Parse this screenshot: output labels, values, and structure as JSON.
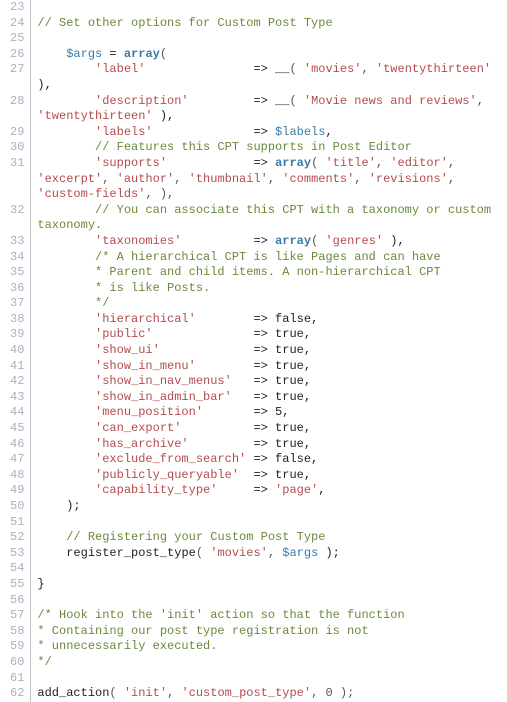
{
  "lines": [
    {
      "n": 23,
      "tokens": []
    },
    {
      "n": 24,
      "tokens": [
        {
          "c": "tok-comment",
          "t": "// Set other options for Custom Post Type"
        }
      ]
    },
    {
      "n": 25,
      "tokens": []
    },
    {
      "n": 26,
      "tokens": [
        {
          "c": "tok-plain",
          "t": "    "
        },
        {
          "c": "tok-var",
          "t": "$args"
        },
        {
          "c": "tok-plain",
          "t": " = "
        },
        {
          "c": "tok-keyword",
          "t": "array"
        },
        {
          "c": "tok-punct",
          "t": "("
        }
      ]
    },
    {
      "n": 27,
      "tokens": [
        {
          "c": "tok-plain",
          "t": "        "
        },
        {
          "c": "tok-string",
          "t": "'label'"
        },
        {
          "c": "tok-plain",
          "t": "               => "
        },
        {
          "c": "tok-func",
          "t": "__"
        },
        {
          "c": "tok-punct",
          "t": "( "
        },
        {
          "c": "tok-string",
          "t": "'movies'"
        },
        {
          "c": "tok-punct",
          "t": ", "
        },
        {
          "c": "tok-string",
          "t": "'twentythirteen'"
        },
        {
          "c": "tok-plain",
          "t": " ),"
        }
      ]
    },
    {
      "n": 28,
      "tokens": [
        {
          "c": "tok-plain",
          "t": "        "
        },
        {
          "c": "tok-string",
          "t": "'description'"
        },
        {
          "c": "tok-plain",
          "t": "         => "
        },
        {
          "c": "tok-func",
          "t": "__"
        },
        {
          "c": "tok-punct",
          "t": "( "
        },
        {
          "c": "tok-string",
          "t": "'Movie news and reviews'"
        },
        {
          "c": "tok-punct",
          "t": ", "
        },
        {
          "c": "tok-string",
          "t": "'twentythirteen'"
        },
        {
          "c": "tok-plain",
          "t": " ),"
        }
      ]
    },
    {
      "n": 29,
      "tokens": [
        {
          "c": "tok-plain",
          "t": "        "
        },
        {
          "c": "tok-string",
          "t": "'labels'"
        },
        {
          "c": "tok-plain",
          "t": "              => "
        },
        {
          "c": "tok-var",
          "t": "$labels"
        },
        {
          "c": "tok-plain",
          "t": ","
        }
      ]
    },
    {
      "n": 30,
      "tokens": [
        {
          "c": "tok-plain",
          "t": "        "
        },
        {
          "c": "tok-comment",
          "t": "// Features this CPT supports in Post Editor"
        }
      ]
    },
    {
      "n": 31,
      "tokens": [
        {
          "c": "tok-plain",
          "t": "        "
        },
        {
          "c": "tok-string",
          "t": "'supports'"
        },
        {
          "c": "tok-plain",
          "t": "            => "
        },
        {
          "c": "tok-keyword",
          "t": "array"
        },
        {
          "c": "tok-punct",
          "t": "( "
        },
        {
          "c": "tok-string",
          "t": "'title'"
        },
        {
          "c": "tok-punct",
          "t": ", "
        },
        {
          "c": "tok-string",
          "t": "'editor'"
        },
        {
          "c": "tok-punct",
          "t": ", "
        },
        {
          "c": "tok-string",
          "t": "'excerpt'"
        },
        {
          "c": "tok-punct",
          "t": ", "
        },
        {
          "c": "tok-string",
          "t": "'author'"
        },
        {
          "c": "tok-punct",
          "t": ", "
        },
        {
          "c": "tok-string",
          "t": "'thumbnail'"
        },
        {
          "c": "tok-punct",
          "t": ", "
        },
        {
          "c": "tok-string",
          "t": "'comments'"
        },
        {
          "c": "tok-punct",
          "t": ", "
        },
        {
          "c": "tok-string",
          "t": "'revisions'"
        },
        {
          "c": "tok-punct",
          "t": ", "
        },
        {
          "c": "tok-string",
          "t": "'custom-fields'"
        },
        {
          "c": "tok-punct",
          "t": ", ),"
        }
      ]
    },
    {
      "n": 32,
      "tokens": [
        {
          "c": "tok-plain",
          "t": "        "
        },
        {
          "c": "tok-comment",
          "t": "// You can associate this CPT with a taxonomy or custom taxonomy."
        }
      ]
    },
    {
      "n": 33,
      "tokens": [
        {
          "c": "tok-plain",
          "t": "        "
        },
        {
          "c": "tok-string",
          "t": "'taxonomies'"
        },
        {
          "c": "tok-plain",
          "t": "          => "
        },
        {
          "c": "tok-keyword",
          "t": "array"
        },
        {
          "c": "tok-punct",
          "t": "( "
        },
        {
          "c": "tok-string",
          "t": "'genres'"
        },
        {
          "c": "tok-plain",
          "t": " ),"
        }
      ]
    },
    {
      "n": 34,
      "tokens": [
        {
          "c": "tok-plain",
          "t": "        "
        },
        {
          "c": "tok-comment",
          "t": "/* A hierarchical CPT is like Pages and can have"
        }
      ]
    },
    {
      "n": 35,
      "tokens": [
        {
          "c": "tok-plain",
          "t": "        "
        },
        {
          "c": "tok-comment",
          "t": "* Parent and child items. A non-hierarchical CPT"
        }
      ]
    },
    {
      "n": 36,
      "tokens": [
        {
          "c": "tok-plain",
          "t": "        "
        },
        {
          "c": "tok-comment",
          "t": "* is like Posts."
        }
      ]
    },
    {
      "n": 37,
      "tokens": [
        {
          "c": "tok-plain",
          "t": "        "
        },
        {
          "c": "tok-comment",
          "t": "*/"
        }
      ]
    },
    {
      "n": 38,
      "tokens": [
        {
          "c": "tok-plain",
          "t": "        "
        },
        {
          "c": "tok-string",
          "t": "'hierarchical'"
        },
        {
          "c": "tok-plain",
          "t": "        => false,"
        }
      ]
    },
    {
      "n": 39,
      "tokens": [
        {
          "c": "tok-plain",
          "t": "        "
        },
        {
          "c": "tok-string",
          "t": "'public'"
        },
        {
          "c": "tok-plain",
          "t": "              => true,"
        }
      ]
    },
    {
      "n": 40,
      "tokens": [
        {
          "c": "tok-plain",
          "t": "        "
        },
        {
          "c": "tok-string",
          "t": "'show_ui'"
        },
        {
          "c": "tok-plain",
          "t": "             => true,"
        }
      ]
    },
    {
      "n": 41,
      "tokens": [
        {
          "c": "tok-plain",
          "t": "        "
        },
        {
          "c": "tok-string",
          "t": "'show_in_menu'"
        },
        {
          "c": "tok-plain",
          "t": "        => true,"
        }
      ]
    },
    {
      "n": 42,
      "tokens": [
        {
          "c": "tok-plain",
          "t": "        "
        },
        {
          "c": "tok-string",
          "t": "'show_in_nav_menus'"
        },
        {
          "c": "tok-plain",
          "t": "   => true,"
        }
      ]
    },
    {
      "n": 43,
      "tokens": [
        {
          "c": "tok-plain",
          "t": "        "
        },
        {
          "c": "tok-string",
          "t": "'show_in_admin_bar'"
        },
        {
          "c": "tok-plain",
          "t": "   => true,"
        }
      ]
    },
    {
      "n": 44,
      "tokens": [
        {
          "c": "tok-plain",
          "t": "        "
        },
        {
          "c": "tok-string",
          "t": "'menu_position'"
        },
        {
          "c": "tok-plain",
          "t": "       => 5,"
        }
      ]
    },
    {
      "n": 45,
      "tokens": [
        {
          "c": "tok-plain",
          "t": "        "
        },
        {
          "c": "tok-string",
          "t": "'can_export'"
        },
        {
          "c": "tok-plain",
          "t": "          => true,"
        }
      ]
    },
    {
      "n": 46,
      "tokens": [
        {
          "c": "tok-plain",
          "t": "        "
        },
        {
          "c": "tok-string",
          "t": "'has_archive'"
        },
        {
          "c": "tok-plain",
          "t": "         => true,"
        }
      ]
    },
    {
      "n": 47,
      "tokens": [
        {
          "c": "tok-plain",
          "t": "        "
        },
        {
          "c": "tok-string",
          "t": "'exclude_from_search'"
        },
        {
          "c": "tok-plain",
          "t": " => false,"
        }
      ]
    },
    {
      "n": 48,
      "tokens": [
        {
          "c": "tok-plain",
          "t": "        "
        },
        {
          "c": "tok-string",
          "t": "'publicly_queryable'"
        },
        {
          "c": "tok-plain",
          "t": "  => true,"
        }
      ]
    },
    {
      "n": 49,
      "tokens": [
        {
          "c": "tok-plain",
          "t": "        "
        },
        {
          "c": "tok-string",
          "t": "'capability_type'"
        },
        {
          "c": "tok-plain",
          "t": "     => "
        },
        {
          "c": "tok-string",
          "t": "'page'"
        },
        {
          "c": "tok-plain",
          "t": ","
        }
      ]
    },
    {
      "n": 50,
      "tokens": [
        {
          "c": "tok-plain",
          "t": "    );"
        }
      ]
    },
    {
      "n": 51,
      "tokens": []
    },
    {
      "n": 52,
      "tokens": [
        {
          "c": "tok-plain",
          "t": "    "
        },
        {
          "c": "tok-comment",
          "t": "// Registering your Custom Post Type"
        }
      ]
    },
    {
      "n": 53,
      "tokens": [
        {
          "c": "tok-plain",
          "t": "    "
        },
        {
          "c": "tok-func",
          "t": "register_post_type"
        },
        {
          "c": "tok-punct",
          "t": "( "
        },
        {
          "c": "tok-string",
          "t": "'movies'"
        },
        {
          "c": "tok-punct",
          "t": ", "
        },
        {
          "c": "tok-var",
          "t": "$args"
        },
        {
          "c": "tok-plain",
          "t": " );"
        }
      ]
    },
    {
      "n": 54,
      "tokens": []
    },
    {
      "n": 55,
      "tokens": [
        {
          "c": "tok-plain",
          "t": "}"
        }
      ]
    },
    {
      "n": 56,
      "tokens": []
    },
    {
      "n": 57,
      "tokens": [
        {
          "c": "tok-comment",
          "t": "/* Hook into the 'init' action so that the function"
        }
      ]
    },
    {
      "n": 58,
      "tokens": [
        {
          "c": "tok-comment",
          "t": "* Containing our post type registration is not"
        }
      ]
    },
    {
      "n": 59,
      "tokens": [
        {
          "c": "tok-comment",
          "t": "* unnecessarily executed."
        }
      ]
    },
    {
      "n": 60,
      "tokens": [
        {
          "c": "tok-comment",
          "t": "*/"
        }
      ]
    },
    {
      "n": 61,
      "tokens": []
    },
    {
      "n": 62,
      "tokens": [
        {
          "c": "tok-func",
          "t": "add_action"
        },
        {
          "c": "tok-punct",
          "t": "( "
        },
        {
          "c": "tok-string",
          "t": "'init'"
        },
        {
          "c": "tok-punct",
          "t": ", "
        },
        {
          "c": "tok-string",
          "t": "'custom_post_type'"
        },
        {
          "c": "tok-punct",
          "t": ", 0 );"
        }
      ]
    }
  ]
}
